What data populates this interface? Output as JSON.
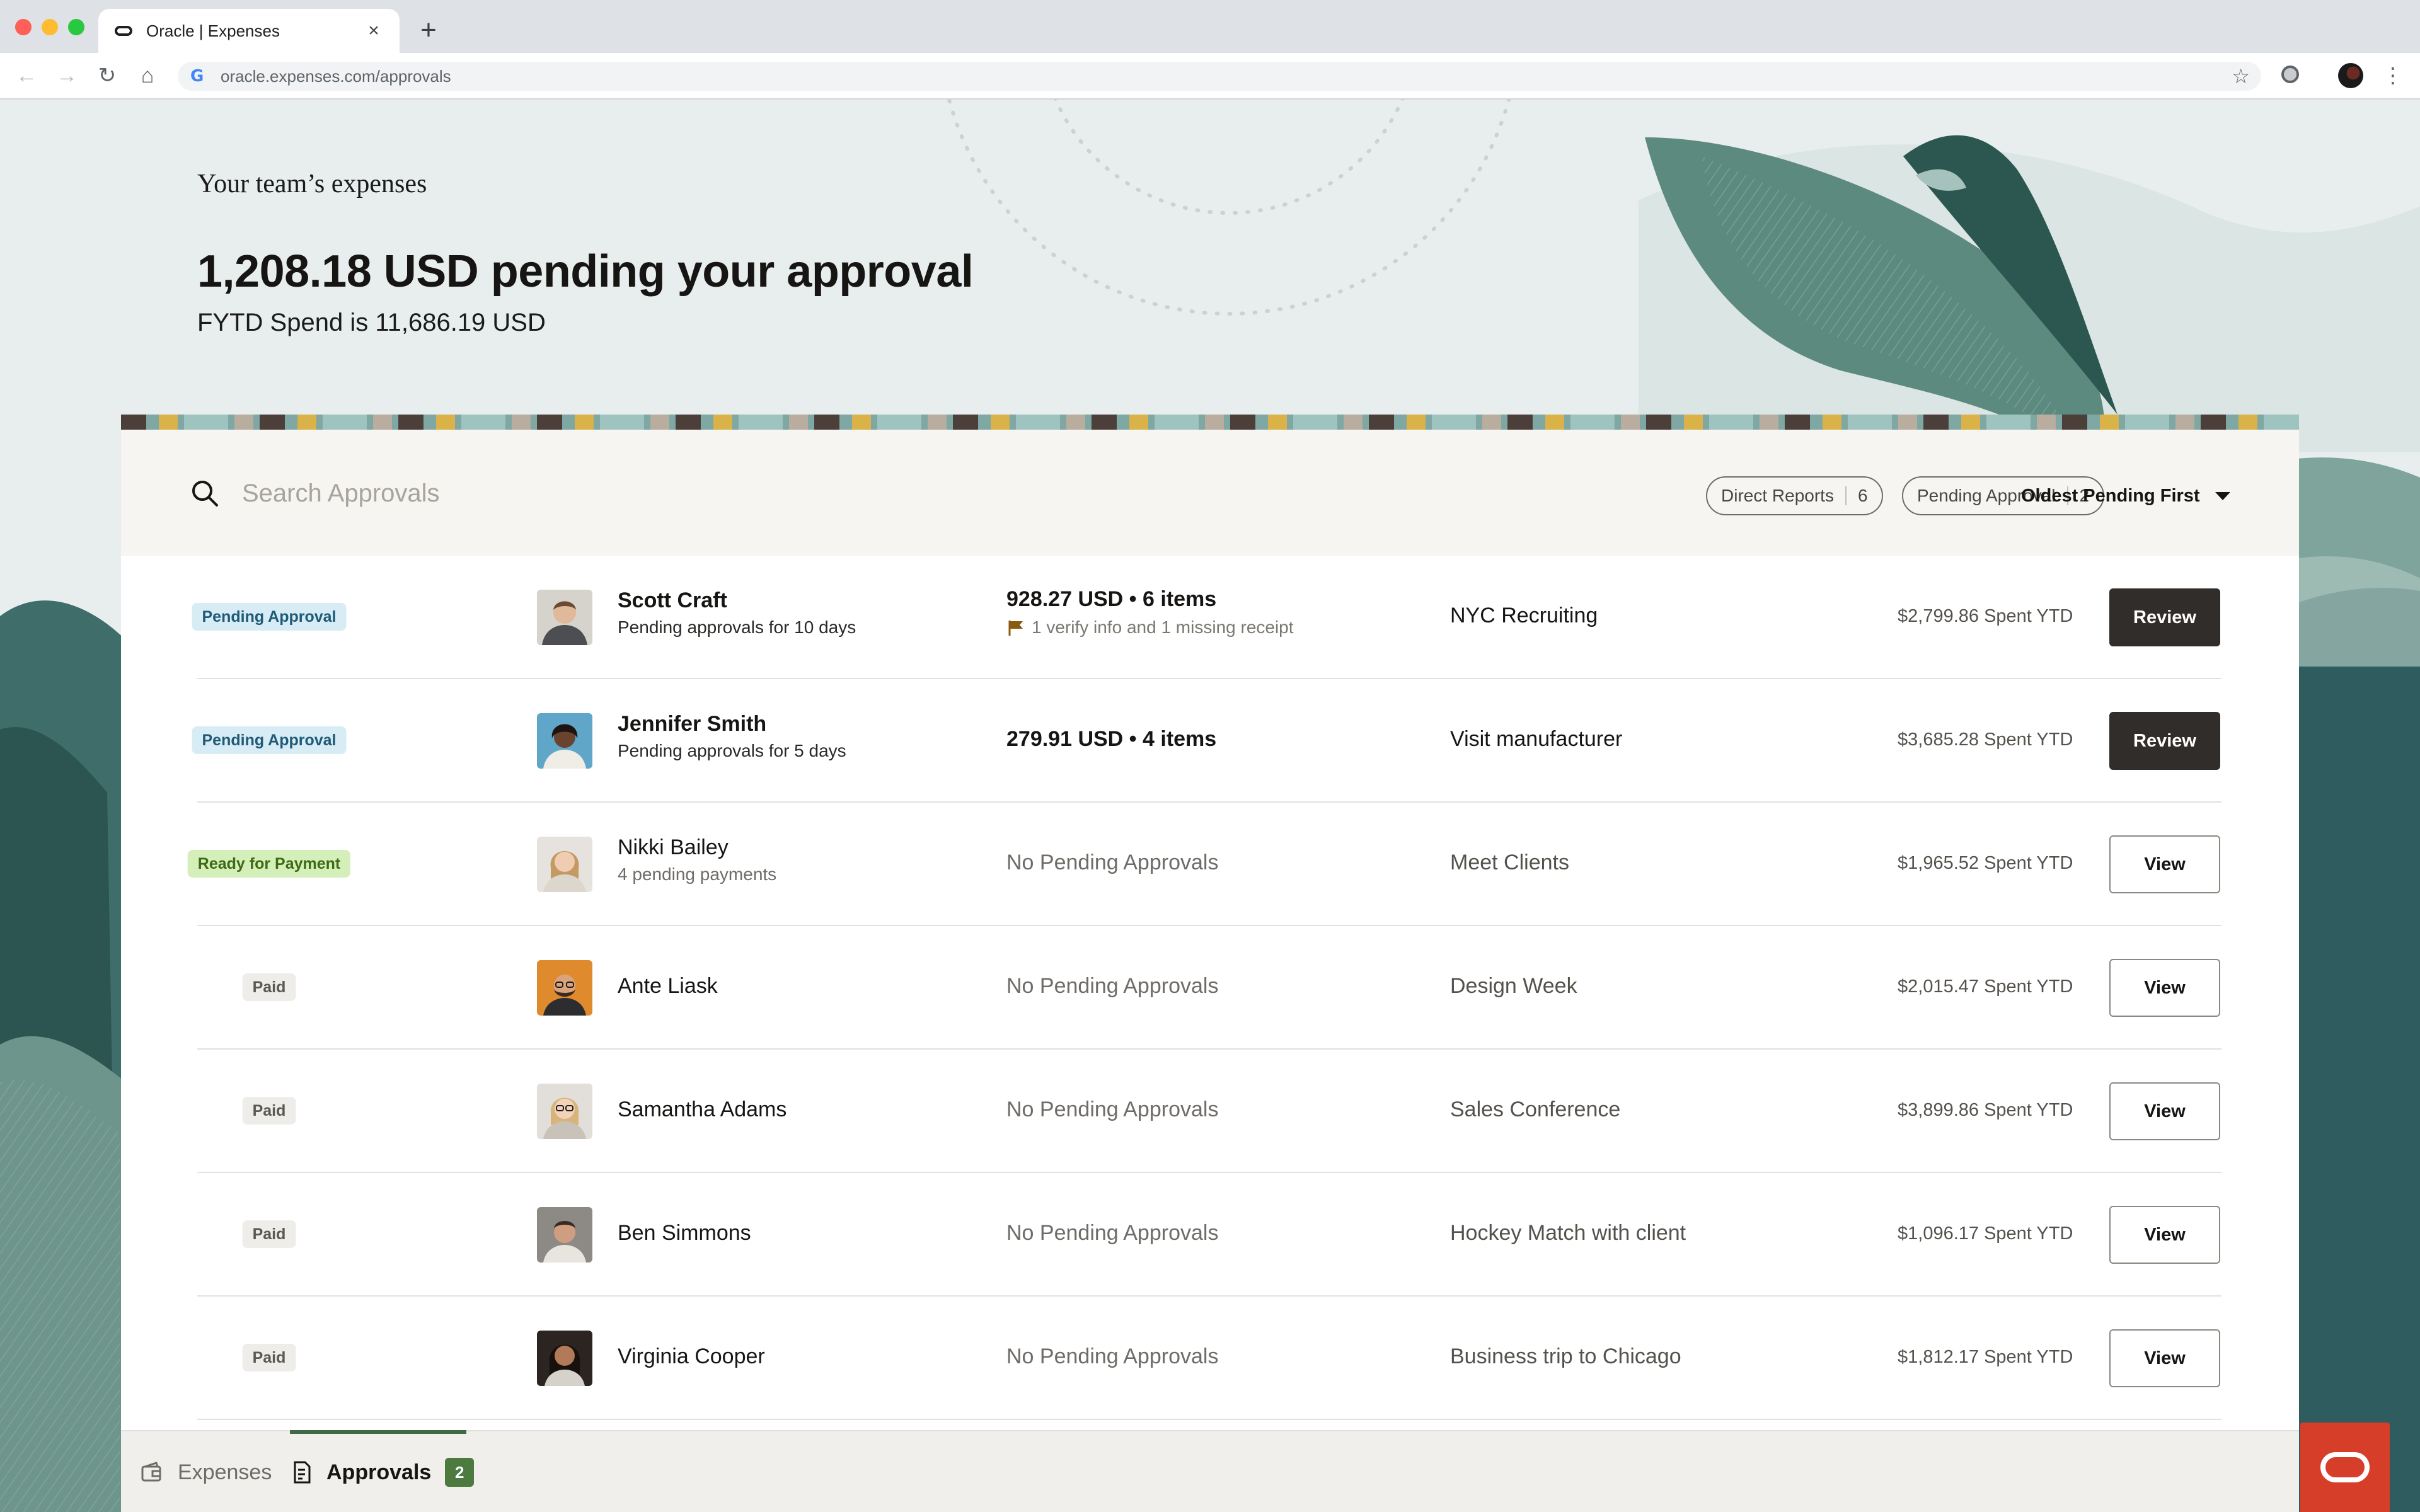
{
  "browser": {
    "tab_title": "Oracle | Expenses",
    "url": "oracle.expenses.com/approvals",
    "new_tab": "+",
    "close_tab": "×"
  },
  "hero": {
    "eyebrow": "Your team’s expenses",
    "title": "1,208.18 USD pending your approval",
    "subtitle": "FYTD Spend is 11,686.19 USD"
  },
  "search": {
    "placeholder": "Search Approvals",
    "value": ""
  },
  "filters": [
    {
      "label": "Direct Reports",
      "count": "6"
    },
    {
      "label": "Pending Approval",
      "count": "2"
    }
  ],
  "sort": {
    "label": "Oldest Pending First"
  },
  "rows": [
    {
      "status": "Pending Approval",
      "name": "Scott Craft",
      "sub": "Pending approvals for 10 days",
      "amount": "928.27 USD • 6 items",
      "note": "1 verify info and 1 missing receipt",
      "trip": "NYC Recruiting",
      "ytd": "$2,799.86 Spent YTD",
      "action": "Review"
    },
    {
      "status": "Pending Approval",
      "name": "Jennifer Smith",
      "sub": "Pending approvals for 5 days",
      "amount": "279.91 USD • 4 items",
      "trip": "Visit manufacturer",
      "ytd": "$3,685.28 Spent YTD",
      "action": "Review"
    },
    {
      "status": "Ready for Payment",
      "name": "Nikki Bailey",
      "sub": "4 pending payments",
      "amount": "No Pending Approvals",
      "trip": "Meet Clients",
      "ytd": "$1,965.52 Spent YTD",
      "action": "View"
    },
    {
      "status": "Paid",
      "name": "Ante Liask",
      "amount": "No Pending Approvals",
      "trip": "Design Week",
      "ytd": "$2,015.47 Spent YTD",
      "action": "View"
    },
    {
      "status": "Paid",
      "name": "Samantha Adams",
      "amount": "No Pending Approvals",
      "trip": "Sales Conference",
      "ytd": "$3,899.86 Spent YTD",
      "action": "View"
    },
    {
      "status": "Paid",
      "name": "Ben Simmons",
      "amount": "No Pending Approvals",
      "trip": "Hockey Match with client",
      "ytd": "$1,096.17 Spent YTD",
      "action": "View"
    },
    {
      "status": "Paid",
      "name": "Virginia Cooper",
      "amount": "No Pending Approvals",
      "trip": "Business trip to Chicago",
      "ytd": "$1,812.17 Spent YTD",
      "action": "View"
    }
  ],
  "bottom_nav": {
    "expenses": "Expenses",
    "approvals": "Approvals",
    "approvals_count": "2"
  },
  "colors": {
    "review_button": "#312d2a",
    "pending_badge": "#d7ecf4",
    "ready_badge": "#d4efb9",
    "paid_badge": "#efedea",
    "oracle_red": "#d73e2a",
    "approvals_count_badge": "#4d7a3f"
  }
}
